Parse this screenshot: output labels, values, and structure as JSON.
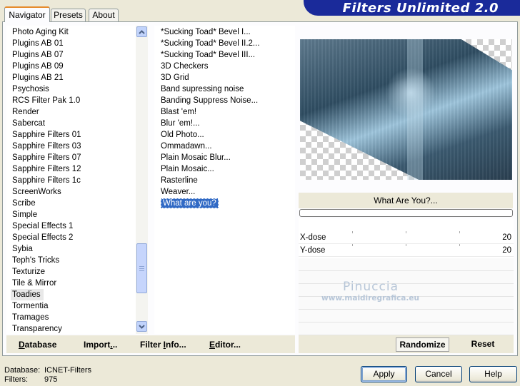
{
  "banner": {
    "title": "Filters Unlimited 2.0"
  },
  "tabs": [
    {
      "label": "Navigator",
      "active": true
    },
    {
      "label": "Presets",
      "active": false
    },
    {
      "label": "About",
      "active": false
    }
  ],
  "categories": {
    "items": [
      "Photo Aging Kit",
      "Plugins AB 01",
      "Plugins AB 07",
      "Plugins AB 09",
      "Plugins AB 21",
      "Psychosis",
      "RCS Filter Pak 1.0",
      "Render",
      "Sabercat",
      "Sapphire Filters 01",
      "Sapphire Filters 03",
      "Sapphire Filters 07",
      "Sapphire Filters 12",
      "Sapphire Filters 1c",
      "ScreenWorks",
      "Scribe",
      "Simple",
      "Special Effects 1",
      "Special Effects 2",
      "Sybia",
      "Teph's Tricks",
      "Texturize",
      "Tile & Mirror",
      "Toadies",
      "Tormentia",
      "Tramages",
      "Transparency"
    ],
    "highlighted": "Toadies"
  },
  "filters": {
    "items": [
      "*Sucking Toad*  Bevel I...",
      "*Sucking Toad*  Bevel II.2...",
      "*Sucking Toad*  Bevel III...",
      "3D Checkers",
      "3D Grid",
      "Band supressing noise",
      "Banding Suppress Noise...",
      "Blast 'em!",
      "Blur 'em!...",
      "Old Photo...",
      "Ommadawn...",
      "Plain Mosaic Blur...",
      "Plain Mosaic...",
      "Rasterline",
      "Weaver...",
      "What are you?"
    ],
    "selected": "What are you?"
  },
  "preview": {
    "filter_name": "What Are You?..."
  },
  "params": [
    {
      "name": "X-dose",
      "value": "20"
    },
    {
      "name": "Y-dose",
      "value": "20"
    }
  ],
  "watermark": {
    "line1": "Pinuccia",
    "line2": "www.maidiregrafica.eu"
  },
  "toolbar": {
    "database": {
      "u": "D",
      "rest": "atabase"
    },
    "import": {
      "pre": "Import",
      "u": ".",
      "rest": ".."
    },
    "filter_info": {
      "pre": "Filter ",
      "u": "I",
      "rest": "nfo..."
    },
    "editor": {
      "u": "E",
      "rest": "ditor..."
    },
    "randomize": "Randomize",
    "reset": "Reset"
  },
  "buttons": {
    "apply": "Apply",
    "cancel": "Cancel",
    "help": "Help"
  },
  "status": {
    "database_label": "Database:",
    "database_value": "ICNET-Filters",
    "filters_label": "Filters:",
    "filters_value": "975"
  }
}
